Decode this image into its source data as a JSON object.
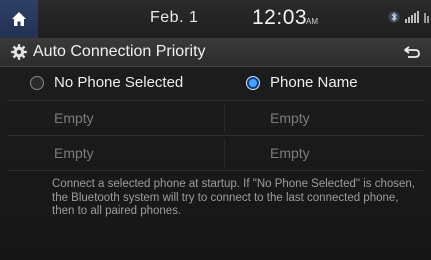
{
  "statusbar": {
    "date": "Feb.  1",
    "time": "12:03",
    "ampm": "AM",
    "icons": [
      "home-icon",
      "bluetooth-icon",
      "signal-icon",
      "network-icon"
    ]
  },
  "header": {
    "title": "Auto Connection Priority",
    "icon": "gear-icon",
    "back_icon": "back-icon"
  },
  "options": [
    {
      "label": "No Phone Selected",
      "selected": false
    },
    {
      "label": "Phone Name",
      "selected": true
    }
  ],
  "slots": {
    "left": [
      "Empty",
      "Empty"
    ],
    "right": [
      "Empty",
      "Empty"
    ]
  },
  "description": "Connect a selected phone at startup. If \"No Phone Selected\" is chosen, the Bluetooth system will try to connect to the last connected phone, then to all paired phones.",
  "colors": {
    "accent": "#4aa2ff",
    "home_button": "#2f3f66"
  }
}
